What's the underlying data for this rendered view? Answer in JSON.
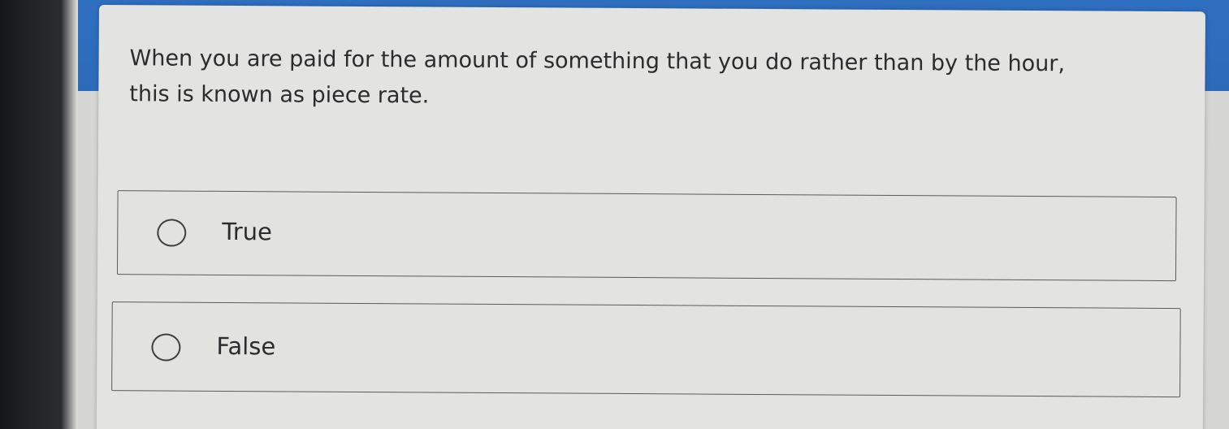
{
  "question": {
    "line1": "When you are paid for the amount of something that you do rather than by the hour,",
    "line2": "this is known as piece rate."
  },
  "options": [
    {
      "label": "True",
      "selected": false
    },
    {
      "label": "False",
      "selected": false
    }
  ],
  "colors": {
    "accent_band": "#2f6fc0",
    "card_background": "#e3e3e1",
    "option_border": "#5a5b5d",
    "text": "#2b2c2e"
  }
}
